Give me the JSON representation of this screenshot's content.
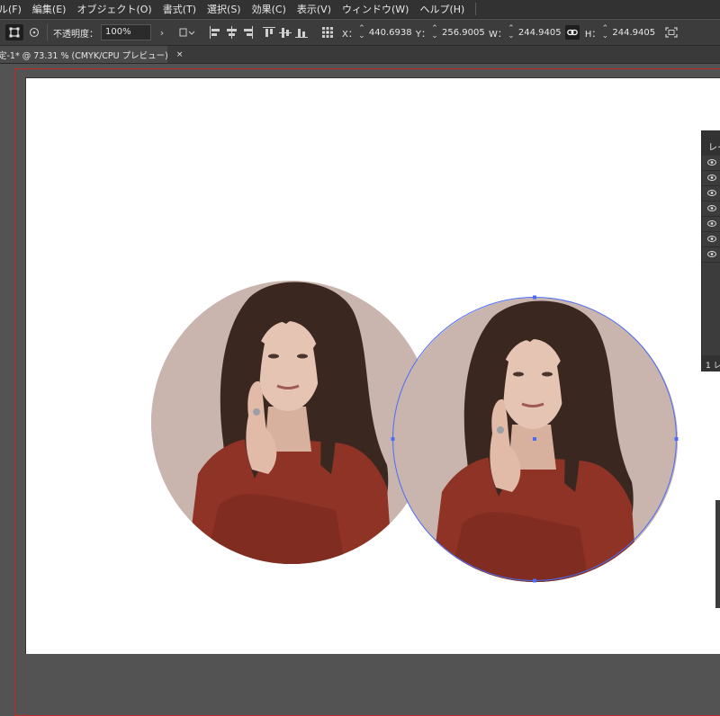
{
  "menubar": {
    "items": [
      "ル(F)",
      "編集(E)",
      "オブジェクト(O)",
      "書式(T)",
      "選択(S)",
      "効果(C)",
      "表示(V)",
      "ウィンドウ(W)",
      "ヘルプ(H)"
    ]
  },
  "controlbar": {
    "opacity_label": "不透明度：",
    "opacity_value": "100%",
    "x_label": "X：",
    "x_value": "440.6938",
    "y_label": "Y：",
    "y_value": "256.9005",
    "w_label": "W：",
    "w_value": "244.9405",
    "h_label": "H：",
    "h_value": "244.9405",
    "chevron": "›"
  },
  "document_tab": {
    "title": "定-1* @ 73.31 % (CMYK/CPU プレビュー)",
    "close": "×"
  },
  "layers_panel": {
    "header": "レイ",
    "footer": "1 レ",
    "rows": 7
  },
  "colors": {
    "ui_dark": "#323232",
    "canvas_gray": "#535353",
    "artboard_border": "#c12a2a",
    "selection_blue": "#4a6cf7",
    "photo_bg": "#c9b4ae",
    "sweater": "#8e3325",
    "hair": "#3a2820",
    "skin": "#e5c4b3"
  },
  "icons": [
    "transform-icon",
    "recolor-icon",
    "chevron-right-icon",
    "shape-options-icon",
    "align-left-icon",
    "align-center-icon",
    "align-right-icon",
    "align-top-icon",
    "align-middle-icon",
    "align-bottom-icon",
    "reference-point-icon",
    "stepper-icon",
    "link-proportions-icon",
    "close-icon",
    "eye-icon",
    "isolate-icon"
  ]
}
